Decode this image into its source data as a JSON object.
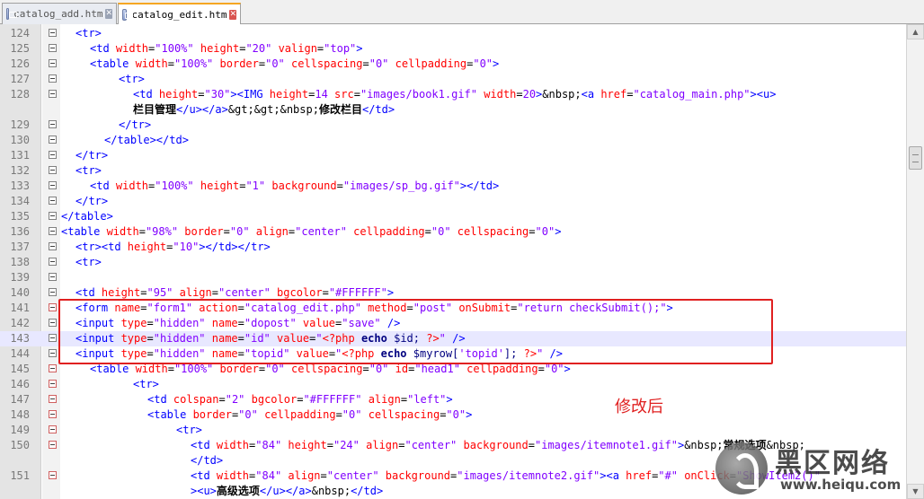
{
  "tabs": [
    {
      "label": "catalog_add.htm",
      "active": false
    },
    {
      "label": "catalog_edit.htm",
      "active": true
    }
  ],
  "editor": {
    "highlighted_line": "143",
    "annotation": "修改后",
    "watermark": {
      "name": "黑区网络",
      "url": "www.heiqu.com"
    },
    "lines": [
      {
        "num": "124",
        "indent": 1,
        "html": "&lt;tr&gt;",
        "segs": [
          [
            "t",
            "<tr>"
          ]
        ]
      },
      {
        "num": "125",
        "indent": 2,
        "segs": [
          [
            "t",
            "<td "
          ],
          [
            "a",
            "width"
          ],
          [
            "e",
            "="
          ],
          [
            "v",
            "\"100%\""
          ],
          [
            "a",
            " height"
          ],
          [
            "e",
            "="
          ],
          [
            "v",
            "\"20\""
          ],
          [
            "a",
            " valign"
          ],
          [
            "e",
            "="
          ],
          [
            "v",
            "\"top\""
          ],
          [
            "t",
            ">"
          ]
        ]
      },
      {
        "num": "126",
        "indent": 2,
        "segs": [
          [
            "t",
            "<table "
          ],
          [
            "a",
            "width"
          ],
          [
            "e",
            "="
          ],
          [
            "v",
            "\"100%\""
          ],
          [
            "a",
            " border"
          ],
          [
            "e",
            "="
          ],
          [
            "v",
            "\"0\""
          ],
          [
            "a",
            " cellspacing"
          ],
          [
            "e",
            "="
          ],
          [
            "v",
            "\"0\""
          ],
          [
            "a",
            " cellpadding"
          ],
          [
            "e",
            "="
          ],
          [
            "v",
            "\"0\""
          ],
          [
            "t",
            ">"
          ]
        ]
      },
      {
        "num": "127",
        "indent": 4,
        "segs": [
          [
            "t",
            "<tr>"
          ]
        ]
      },
      {
        "num": "128",
        "indent": 5,
        "segs": [
          [
            "t",
            "<td "
          ],
          [
            "a",
            "height"
          ],
          [
            "e",
            "="
          ],
          [
            "v",
            "\"30\""
          ],
          [
            "t",
            ">"
          ],
          [
            "t",
            "<IMG "
          ],
          [
            "a",
            "height"
          ],
          [
            "e",
            "="
          ],
          [
            "v",
            "14"
          ],
          [
            "a",
            " src"
          ],
          [
            "e",
            "="
          ],
          [
            "v",
            "\"images/book1.gif\""
          ],
          [
            "a",
            " width"
          ],
          [
            "e",
            "="
          ],
          [
            "v",
            "20"
          ],
          [
            "t",
            ">"
          ],
          [
            "e",
            "&nbsp;"
          ],
          [
            "t",
            "<a "
          ],
          [
            "a",
            "href"
          ],
          [
            "e",
            "="
          ],
          [
            "v",
            "\"catalog_main.php\""
          ],
          [
            "t",
            ">"
          ],
          [
            "t",
            "<u>"
          ]
        ]
      },
      {
        "num": "",
        "indent": 5,
        "segs": [
          [
            "cn",
            "栏目管理"
          ],
          [
            "t",
            "</u></a>"
          ],
          [
            "e",
            "&gt;&gt;&nbsp;"
          ],
          [
            "cn",
            "修改栏目"
          ],
          [
            "t",
            "</td>"
          ]
        ]
      },
      {
        "num": "129",
        "indent": 4,
        "segs": [
          [
            "t",
            "</tr>"
          ]
        ]
      },
      {
        "num": "130",
        "indent": 3,
        "segs": [
          [
            "t",
            "</table></td>"
          ]
        ]
      },
      {
        "num": "131",
        "indent": 1,
        "segs": [
          [
            "t",
            "</tr>"
          ]
        ]
      },
      {
        "num": "132",
        "indent": 1,
        "segs": [
          [
            "t",
            "<tr>"
          ]
        ]
      },
      {
        "num": "133",
        "indent": 2,
        "segs": [
          [
            "t",
            "<td "
          ],
          [
            "a",
            "width"
          ],
          [
            "e",
            "="
          ],
          [
            "v",
            "\"100%\""
          ],
          [
            "a",
            " height"
          ],
          [
            "e",
            "="
          ],
          [
            "v",
            "\"1\""
          ],
          [
            "a",
            " background"
          ],
          [
            "e",
            "="
          ],
          [
            "v",
            "\"images/sp_bg.gif\""
          ],
          [
            "t",
            "></td>"
          ]
        ]
      },
      {
        "num": "134",
        "indent": 1,
        "segs": [
          [
            "t",
            "</tr>"
          ]
        ]
      },
      {
        "num": "135",
        "indent": 0,
        "segs": [
          [
            "t",
            "</table>"
          ]
        ]
      },
      {
        "num": "136",
        "indent": 0,
        "segs": [
          [
            "t",
            "<table "
          ],
          [
            "a",
            "width"
          ],
          [
            "e",
            "="
          ],
          [
            "v",
            "\"98%\""
          ],
          [
            "a",
            " border"
          ],
          [
            "e",
            "="
          ],
          [
            "v",
            "\"0\""
          ],
          [
            "a",
            " align"
          ],
          [
            "e",
            "="
          ],
          [
            "v",
            "\"center\""
          ],
          [
            "a",
            " cellpadding"
          ],
          [
            "e",
            "="
          ],
          [
            "v",
            "\"0\""
          ],
          [
            "a",
            " cellspacing"
          ],
          [
            "e",
            "="
          ],
          [
            "v",
            "\"0\""
          ],
          [
            "t",
            ">"
          ]
        ]
      },
      {
        "num": "137",
        "indent": 1,
        "segs": [
          [
            "t",
            "<tr><td "
          ],
          [
            "a",
            "height"
          ],
          [
            "e",
            "="
          ],
          [
            "v",
            "\"10\""
          ],
          [
            "t",
            "></td></tr>"
          ]
        ]
      },
      {
        "num": "138",
        "indent": 1,
        "segs": [
          [
            "t",
            "<tr>"
          ]
        ]
      },
      {
        "num": "139",
        "indent": 1,
        "segs": []
      },
      {
        "num": "140",
        "indent": 1,
        "segs": [
          [
            "t",
            "<td "
          ],
          [
            "a",
            "height"
          ],
          [
            "e",
            "="
          ],
          [
            "v",
            "\"95\""
          ],
          [
            "a",
            " align"
          ],
          [
            "e",
            "="
          ],
          [
            "v",
            "\"center\""
          ],
          [
            "a",
            " bgcolor"
          ],
          [
            "e",
            "="
          ],
          [
            "v",
            "\"#FFFFFF\""
          ],
          [
            "t",
            ">"
          ]
        ]
      },
      {
        "num": "141",
        "indent": 1,
        "segs": [
          [
            "t",
            "<form "
          ],
          [
            "a",
            "name"
          ],
          [
            "e",
            "="
          ],
          [
            "v",
            "\"form1\""
          ],
          [
            "a",
            " action"
          ],
          [
            "e",
            "="
          ],
          [
            "v",
            "\"catalog_edit.php\""
          ],
          [
            "a",
            " method"
          ],
          [
            "e",
            "="
          ],
          [
            "v",
            "\"post\""
          ],
          [
            "a",
            " onSubmit"
          ],
          [
            "e",
            "="
          ],
          [
            "v",
            "\"return checkSubmit();\""
          ],
          [
            "t",
            ">"
          ]
        ]
      },
      {
        "num": "142",
        "indent": 1,
        "segs": [
          [
            "t",
            "<input "
          ],
          [
            "a",
            "type"
          ],
          [
            "e",
            "="
          ],
          [
            "v",
            "\"hidden\""
          ],
          [
            "a",
            " name"
          ],
          [
            "e",
            "="
          ],
          [
            "v",
            "\"dopost\""
          ],
          [
            "a",
            " value"
          ],
          [
            "e",
            "="
          ],
          [
            "v",
            "\"save\""
          ],
          [
            "t",
            " />"
          ]
        ]
      },
      {
        "num": "143",
        "indent": 1,
        "segs": [
          [
            "t",
            "<input "
          ],
          [
            "a",
            "type"
          ],
          [
            "e",
            "="
          ],
          [
            "v",
            "\"hidden\""
          ],
          [
            "a",
            " name"
          ],
          [
            "e",
            "="
          ],
          [
            "v",
            "\"id\""
          ],
          [
            "a",
            " value"
          ],
          [
            "e",
            "="
          ],
          [
            "v",
            "\""
          ],
          [
            "a",
            "<?php"
          ],
          [
            "ps",
            " echo "
          ],
          [
            "p",
            "$id; "
          ],
          [
            "a",
            "?>"
          ],
          [
            "v",
            "\""
          ],
          [
            "t",
            " />"
          ]
        ]
      },
      {
        "num": "144",
        "indent": 1,
        "segs": [
          [
            "t",
            "<input "
          ],
          [
            "a",
            "type"
          ],
          [
            "e",
            "="
          ],
          [
            "v",
            "\"hidden\""
          ],
          [
            "a",
            " name"
          ],
          [
            "e",
            "="
          ],
          [
            "v",
            "\"topid\""
          ],
          [
            "a",
            " value"
          ],
          [
            "e",
            "="
          ],
          [
            "v",
            "\""
          ],
          [
            "a",
            "<?php"
          ],
          [
            "ps",
            " echo "
          ],
          [
            "p",
            "$myrow["
          ],
          [
            "v",
            "'topid'"
          ],
          [
            "p",
            "]; "
          ],
          [
            "a",
            "?>"
          ],
          [
            "v",
            "\""
          ],
          [
            "t",
            " />"
          ]
        ]
      },
      {
        "num": "145",
        "indent": 2,
        "segs": [
          [
            "t",
            "<table "
          ],
          [
            "a",
            "width"
          ],
          [
            "e",
            "="
          ],
          [
            "v",
            "\"100%\""
          ],
          [
            "a",
            " border"
          ],
          [
            "e",
            "="
          ],
          [
            "v",
            "\"0\""
          ],
          [
            "a",
            " cellspacing"
          ],
          [
            "e",
            "="
          ],
          [
            "v",
            "\"0\""
          ],
          [
            "a",
            " id"
          ],
          [
            "e",
            "="
          ],
          [
            "v",
            "\"head1\""
          ],
          [
            "a",
            " cellpadding"
          ],
          [
            "e",
            "="
          ],
          [
            "v",
            "\"0\""
          ],
          [
            "t",
            ">"
          ]
        ]
      },
      {
        "num": "146",
        "indent": 5,
        "segs": [
          [
            "t",
            "<tr>"
          ]
        ]
      },
      {
        "num": "147",
        "indent": 6,
        "segs": [
          [
            "t",
            "<td "
          ],
          [
            "a",
            "colspan"
          ],
          [
            "e",
            "="
          ],
          [
            "v",
            "\"2\""
          ],
          [
            "a",
            " bgcolor"
          ],
          [
            "e",
            "="
          ],
          [
            "v",
            "\"#FFFFFF\""
          ],
          [
            "a",
            " align"
          ],
          [
            "e",
            "="
          ],
          [
            "v",
            "\"left\""
          ],
          [
            "t",
            ">"
          ]
        ]
      },
      {
        "num": "148",
        "indent": 6,
        "segs": [
          [
            "t",
            "<table "
          ],
          [
            "a",
            "border"
          ],
          [
            "e",
            "="
          ],
          [
            "v",
            "\"0\""
          ],
          [
            "a",
            " cellpadding"
          ],
          [
            "e",
            "="
          ],
          [
            "v",
            "\"0\""
          ],
          [
            "a",
            " cellspacing"
          ],
          [
            "e",
            "="
          ],
          [
            "v",
            "\"0\""
          ],
          [
            "t",
            ">"
          ]
        ]
      },
      {
        "num": "149",
        "indent": 8,
        "segs": [
          [
            "t",
            "<tr>"
          ]
        ]
      },
      {
        "num": "150",
        "indent": 9,
        "segs": [
          [
            "t",
            "<td "
          ],
          [
            "a",
            "width"
          ],
          [
            "e",
            "="
          ],
          [
            "v",
            "\"84\""
          ],
          [
            "a",
            " height"
          ],
          [
            "e",
            "="
          ],
          [
            "v",
            "\"24\""
          ],
          [
            "a",
            " align"
          ],
          [
            "e",
            "="
          ],
          [
            "v",
            "\"center\""
          ],
          [
            "a",
            " background"
          ],
          [
            "e",
            "="
          ],
          [
            "v",
            "\"images/itemnote1.gif\""
          ],
          [
            "t",
            ">"
          ],
          [
            "e",
            "&nbsp;"
          ],
          [
            "cn",
            "常规选项"
          ],
          [
            "e",
            "&nbsp;"
          ]
        ]
      },
      {
        "num": "",
        "indent": 9,
        "segs": [
          [
            "t",
            "</td>"
          ]
        ]
      },
      {
        "num": "151",
        "indent": 9,
        "segs": [
          [
            "t",
            "<td "
          ],
          [
            "a",
            "width"
          ],
          [
            "e",
            "="
          ],
          [
            "v",
            "\"84\""
          ],
          [
            "a",
            " align"
          ],
          [
            "e",
            "="
          ],
          [
            "v",
            "\"center\""
          ],
          [
            "a",
            " background"
          ],
          [
            "e",
            "="
          ],
          [
            "v",
            "\"images/itemnote2.gif\""
          ],
          [
            "t",
            ">"
          ],
          [
            "t",
            "<a "
          ],
          [
            "a",
            "href"
          ],
          [
            "e",
            "="
          ],
          [
            "v",
            "\"#\""
          ],
          [
            "a",
            " onClick"
          ],
          [
            "e",
            "="
          ],
          [
            "v",
            "\"ShowItem2()\""
          ]
        ]
      },
      {
        "num": "",
        "indent": 9,
        "segs": [
          [
            "t",
            "><u>"
          ],
          [
            "cn",
            "高级选项"
          ],
          [
            "t",
            "</u></a>"
          ],
          [
            "e",
            "&nbsp;"
          ],
          [
            "t",
            "</td>"
          ]
        ]
      }
    ]
  }
}
